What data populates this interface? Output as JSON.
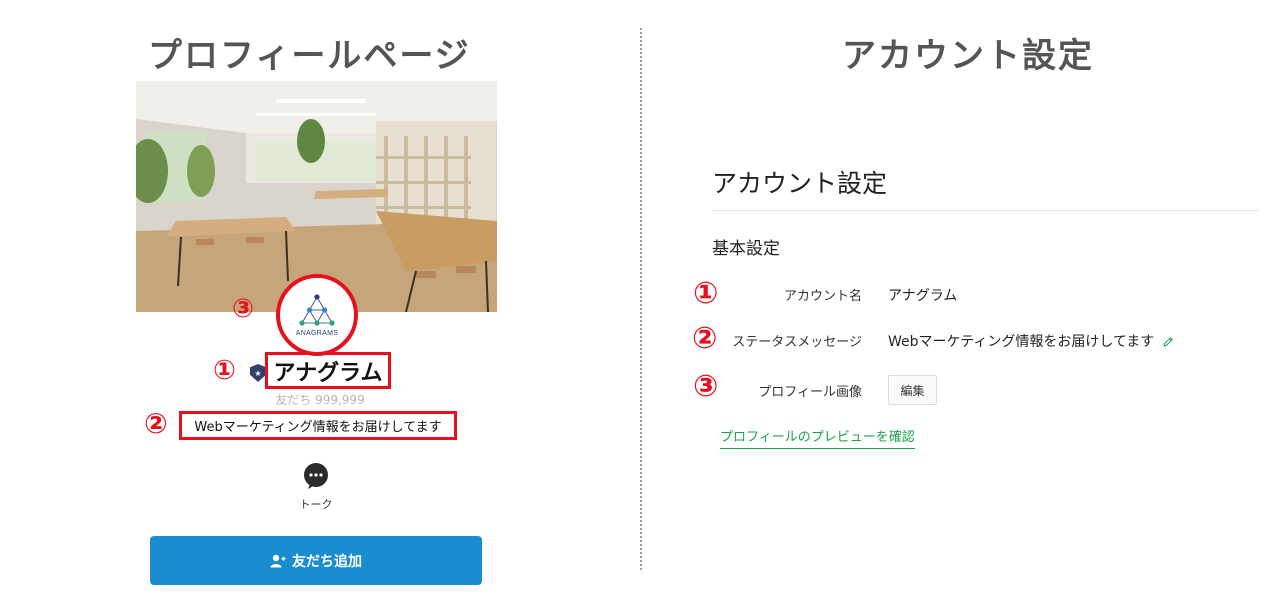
{
  "headings": {
    "left": "プロフィールページ",
    "right": "アカウント設定"
  },
  "profile": {
    "logo_text": "ANAGRAMS",
    "name": "アナグラム",
    "friends": "友だち 999,999",
    "status_message": "Webマーケティング情報をお届けしてます",
    "talk_label": "トーク",
    "add_friend_label": "友だち追加"
  },
  "markers": {
    "one": "①",
    "two": "②",
    "three": "③"
  },
  "settings": {
    "title": "アカウント設定",
    "section": "基本設定",
    "rows": [
      {
        "label": "アカウント名",
        "value": "アナグラム"
      },
      {
        "label": "ステータスメッセージ",
        "value": "Webマーケティング情報をお届けしてます"
      },
      {
        "label": "プロフィール画像",
        "button": "編集"
      }
    ],
    "preview_link": "プロフィールのプレビューを確認"
  },
  "colors": {
    "highlight": "#e8101c",
    "button_blue": "#1b8ccf",
    "link_green": "#1aa34a",
    "badge_navy": "#30406f"
  }
}
